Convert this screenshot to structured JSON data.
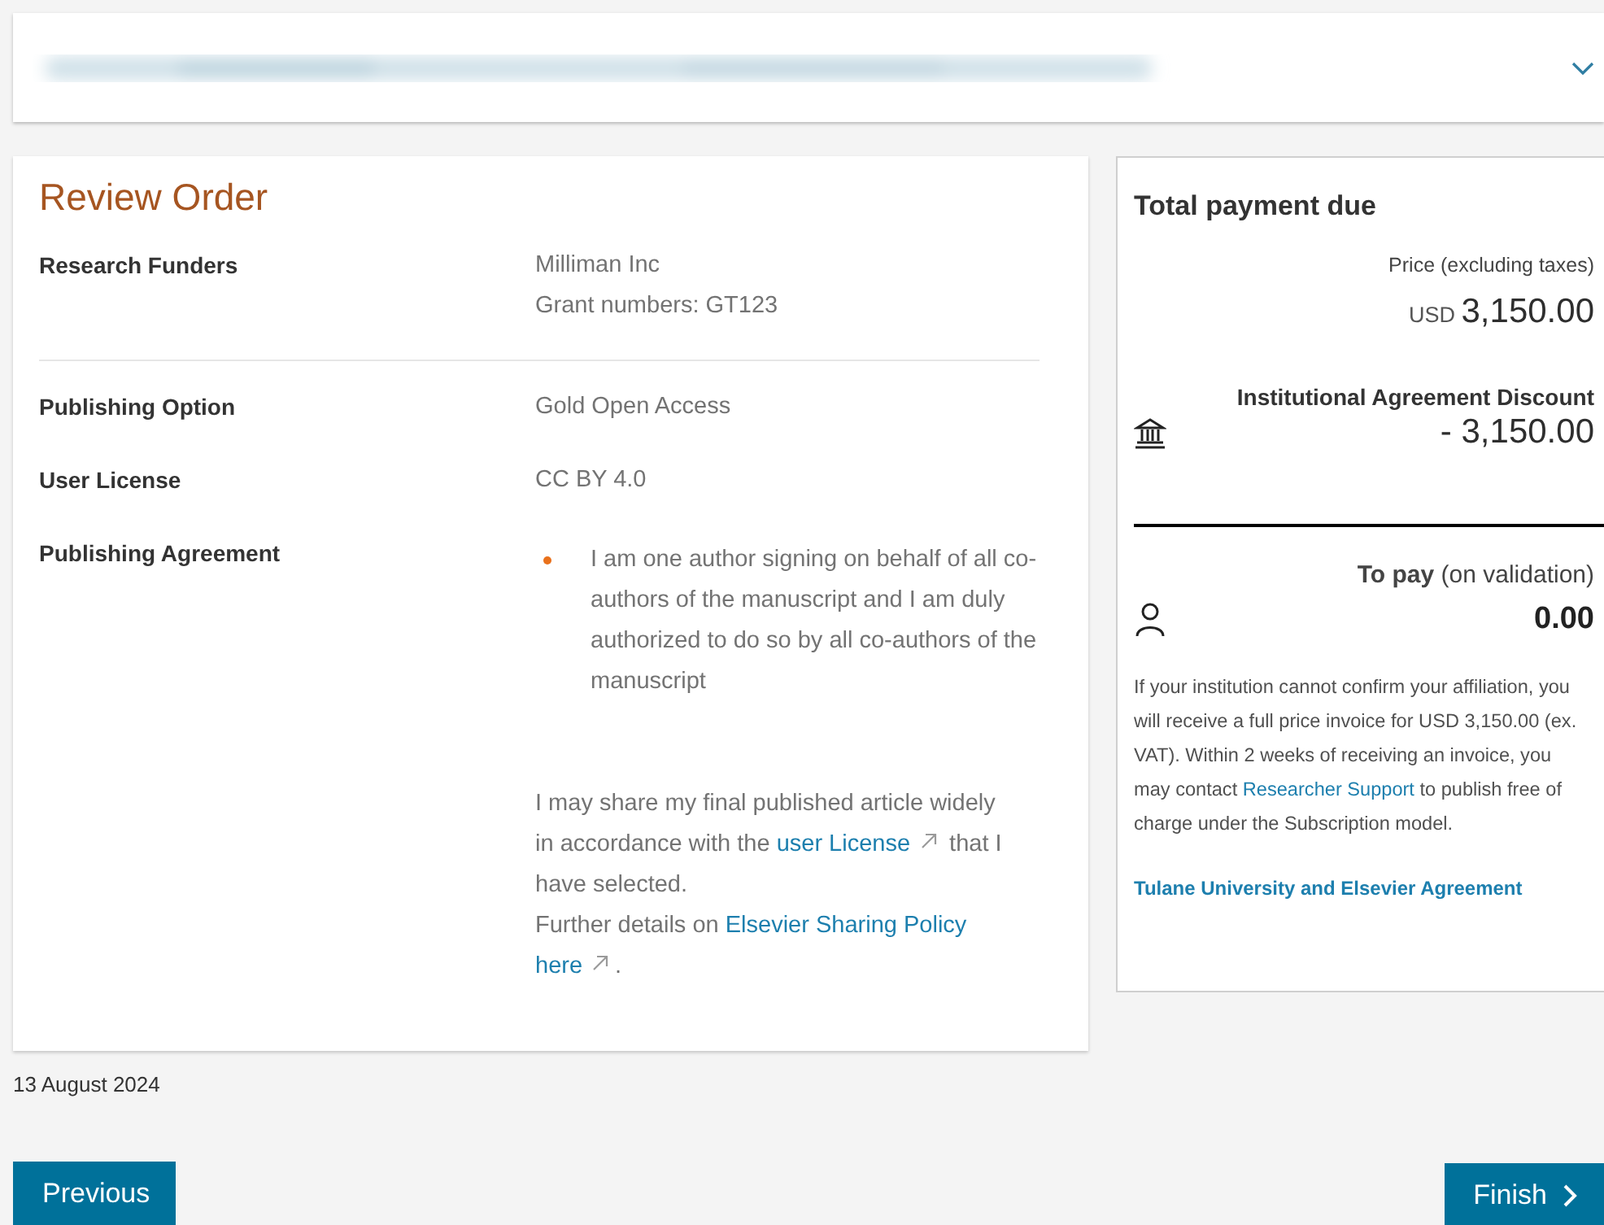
{
  "header": {
    "expanded": false
  },
  "review": {
    "title": "Review Order",
    "rows": [
      {
        "kind": "text",
        "label": "Research Funders",
        "values": [
          "Milliman Inc",
          "Grant numbers: GT123"
        ],
        "divider_after": true
      },
      {
        "kind": "text",
        "label": "Publishing Option",
        "values": [
          "Gold Open Access"
        ],
        "divider_after": false
      },
      {
        "kind": "text",
        "label": "User License",
        "values": [
          "CC BY 4.0"
        ],
        "divider_after": false
      },
      {
        "kind": "agreement",
        "label": "Publishing Agreement",
        "bullets": [
          "I am one author signing on behalf of all co-authors of the manuscript and I am duly authorized to do so by all co-authors of the manuscript"
        ],
        "paragraph": [
          {
            "kind": "text",
            "text": "I may share my final published article widely in accordance with the "
          },
          {
            "kind": "external_link",
            "text": "user License"
          },
          {
            "kind": "text",
            "text": " that I have selected."
          },
          {
            "kind": "break"
          },
          {
            "kind": "text",
            "text": "Further details on "
          },
          {
            "kind": "link",
            "text": "Elsevier Sharing Policy"
          },
          {
            "kind": "break"
          },
          {
            "kind": "external_link",
            "text": "here"
          },
          {
            "kind": "text",
            "text": "."
          }
        ]
      }
    ]
  },
  "payment": {
    "title": "Total payment due",
    "price_label": "Price (excluding taxes)",
    "price_currency": "USD",
    "price_amount": "3,150.00",
    "discount_label": "Institutional Agreement Discount",
    "discount_amount": "- 3,150.00",
    "to_pay_label": "**To pay** (on validation)",
    "to_pay_amount": "0.00",
    "note": [
      {
        "kind": "text",
        "text": "If your institution cannot confirm your affiliation, you will receive a full price invoice for USD 3,150.00 (ex. VAT). Within 2 weeks of receiving an invoice, you may contact "
      },
      {
        "kind": "link",
        "text": "Researcher Support"
      },
      {
        "kind": "text",
        "text": " to publish free of charge under the Subscription model."
      }
    ],
    "agreement_link": "Tulane University and Elsevier Agreement"
  },
  "date": "13 August 2024",
  "buttons": [
    {
      "label": "Previous",
      "kind": "back"
    },
    {
      "label": "Finish",
      "kind": "next"
    }
  ]
}
